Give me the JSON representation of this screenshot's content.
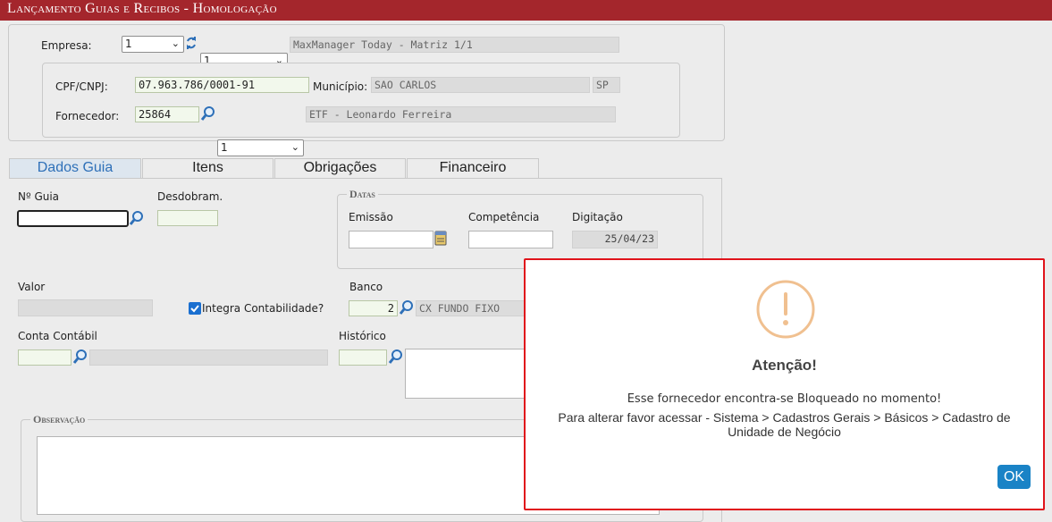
{
  "header": {
    "title": "Lançamento Guias e Recibos  - Homologação"
  },
  "top": {
    "empresa_label": "Empresa:",
    "empresa_select1": "1",
    "empresa_select2": "1",
    "empresa_name": "MaxManager Today - Matriz 1/1",
    "cpf_label": "CPF/CNPJ:",
    "cpf_value": "07.963.786/0001-91",
    "municipio_label": "Município:",
    "municipio_value": "SAO CARLOS",
    "uf_value": "SP",
    "fornecedor_label": "Fornecedor:",
    "fornecedor_code": "25864",
    "fornecedor_select": "1",
    "fornecedor_name": "ETF - Leonardo Ferreira"
  },
  "tabs": [
    {
      "label": "Dados Guia",
      "active": true
    },
    {
      "label": "Itens"
    },
    {
      "label": "Obrigações"
    },
    {
      "label": "Financeiro"
    }
  ],
  "form": {
    "guia_label": "Nº Guia",
    "desdobram_label": "Desdobram.",
    "datas_legend": "Datas",
    "emissao_label": "Emissão",
    "competencia_label": "Competência",
    "digitacao_label": "Digitação",
    "digitacao_value": "25/04/23",
    "valor_label": "Valor",
    "integra_label": "Integra Contabilidade?",
    "banco_label": "Banco",
    "banco_code": "2",
    "banco_name": "CX FUNDO FIXO",
    "conta_label": "Conta Contábil",
    "historico_label": "Histórico",
    "observacao_legend": "Observação"
  },
  "dialog": {
    "title": "Atenção!",
    "message1": "Esse fornecedor encontra-se Bloqueado no momento!",
    "message2": "Para alterar favor acessar - Sistema > Cadastros Gerais > Básicos > Cadastro de Unidade de Negócio",
    "ok_label": "OK",
    "accent_color": "#f0c090",
    "button_color": "#1a83c6"
  },
  "colors": {
    "header_bg": "#a4262c",
    "active_tab": "#2e70b8"
  },
  "icons": [
    "refresh-icon",
    "search-icon",
    "calendar-icon",
    "warning-icon",
    "checkbox-checked-icon"
  ]
}
